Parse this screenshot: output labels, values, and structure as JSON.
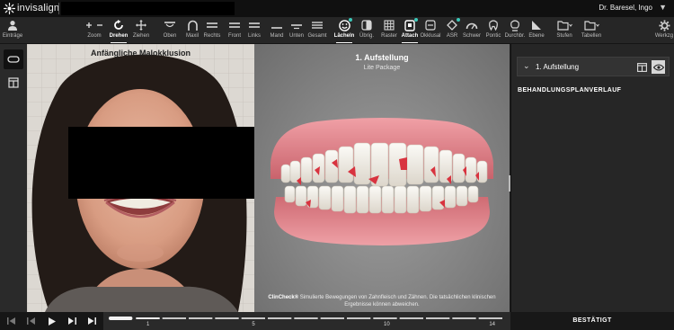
{
  "app": {
    "brand": "invisalign",
    "user": "Dr. Baresel, Ingo"
  },
  "toolbar": [
    {
      "key": "eintraege",
      "label": "Einträge",
      "icon": "person-icon",
      "active": false
    },
    {
      "key": "zoom",
      "label": "Zoom",
      "icon": "zoom-icon",
      "active": false
    },
    {
      "key": "drehen",
      "label": "Drehen",
      "icon": "rotate-icon",
      "active": true
    },
    {
      "key": "ziehen",
      "label": "Ziehen",
      "icon": "move-icon",
      "active": false
    },
    {
      "key": "oben",
      "label": "Oben",
      "icon": "view-top-icon",
      "active": false
    },
    {
      "key": "maxil",
      "label": "Maxil",
      "icon": "arch-icon",
      "active": false
    },
    {
      "key": "rechts",
      "label": "Rechts",
      "icon": "view-right-icon",
      "active": false
    },
    {
      "key": "front",
      "label": "Front",
      "icon": "view-front-icon",
      "active": false
    },
    {
      "key": "links",
      "label": "Links",
      "icon": "view-left-icon",
      "active": false
    },
    {
      "key": "mand",
      "label": "Mand",
      "icon": "mandible-icon",
      "active": false
    },
    {
      "key": "unten",
      "label": "Unten",
      "icon": "view-bottom-icon",
      "active": false
    },
    {
      "key": "gesamt",
      "label": "Gesamt",
      "icon": "view-all-icon",
      "active": false
    },
    {
      "key": "laecheln",
      "label": "Lächeln",
      "icon": "smile-icon",
      "active": true
    },
    {
      "key": "uebrig",
      "label": "Übrig.",
      "icon": "overlay-icon",
      "active": false
    },
    {
      "key": "raster",
      "label": "Raster",
      "icon": "grid-icon",
      "active": false
    },
    {
      "key": "attach",
      "label": "Attach",
      "icon": "attachment-icon",
      "active": true
    },
    {
      "key": "okklusal",
      "label": "Okklusal",
      "icon": "occlusal-icon",
      "active": false
    },
    {
      "key": "asr",
      "label": "ASR",
      "icon": "diamond-icon",
      "active": false
    },
    {
      "key": "schwer",
      "label": "Schwer",
      "icon": "gauge-icon",
      "active": false
    },
    {
      "key": "pontic",
      "label": "Pontic",
      "icon": "pontic-icon",
      "active": false
    },
    {
      "key": "durchbr",
      "label": "Durchbr.",
      "icon": "eruption-icon",
      "active": false
    },
    {
      "key": "ebene",
      "label": "Ebene",
      "icon": "plane-icon",
      "active": false
    },
    {
      "key": "stufen",
      "label": "Stufen",
      "icon": "folder-icon",
      "active": false
    },
    {
      "key": "tabellen",
      "label": "Tabellen",
      "icon": "folder-icon",
      "active": false
    },
    {
      "key": "werkzg",
      "label": "Werkzg",
      "icon": "gear-icon",
      "active": false
    }
  ],
  "photo": {
    "title": "Anfängliche Malokklusion"
  },
  "model": {
    "stage_title": "1. Aufstellung",
    "package": "Lite Package",
    "disclaimer_brand": "ClinCheck®",
    "disclaimer_text": " Simulierte Bewegungen von Zahnfleisch und Zähnen. Die tatsächlichen klinischen Ergebnisse können abweichen."
  },
  "right_panel": {
    "stage_label": "1. Aufstellung",
    "history_title": "BEHANDLUNGSPLANVERLAUF",
    "confirmed": "BESTÄTIGT"
  },
  "timeline": {
    "stages_total": 14,
    "current_stage": 1,
    "tick_labels": [
      "1",
      "5",
      "10",
      "14"
    ]
  },
  "colors": {
    "accent": "#3cc7b8",
    "gum": "#e2828a",
    "tooth": "#f4f1ea",
    "attachment": "#d8333f"
  }
}
